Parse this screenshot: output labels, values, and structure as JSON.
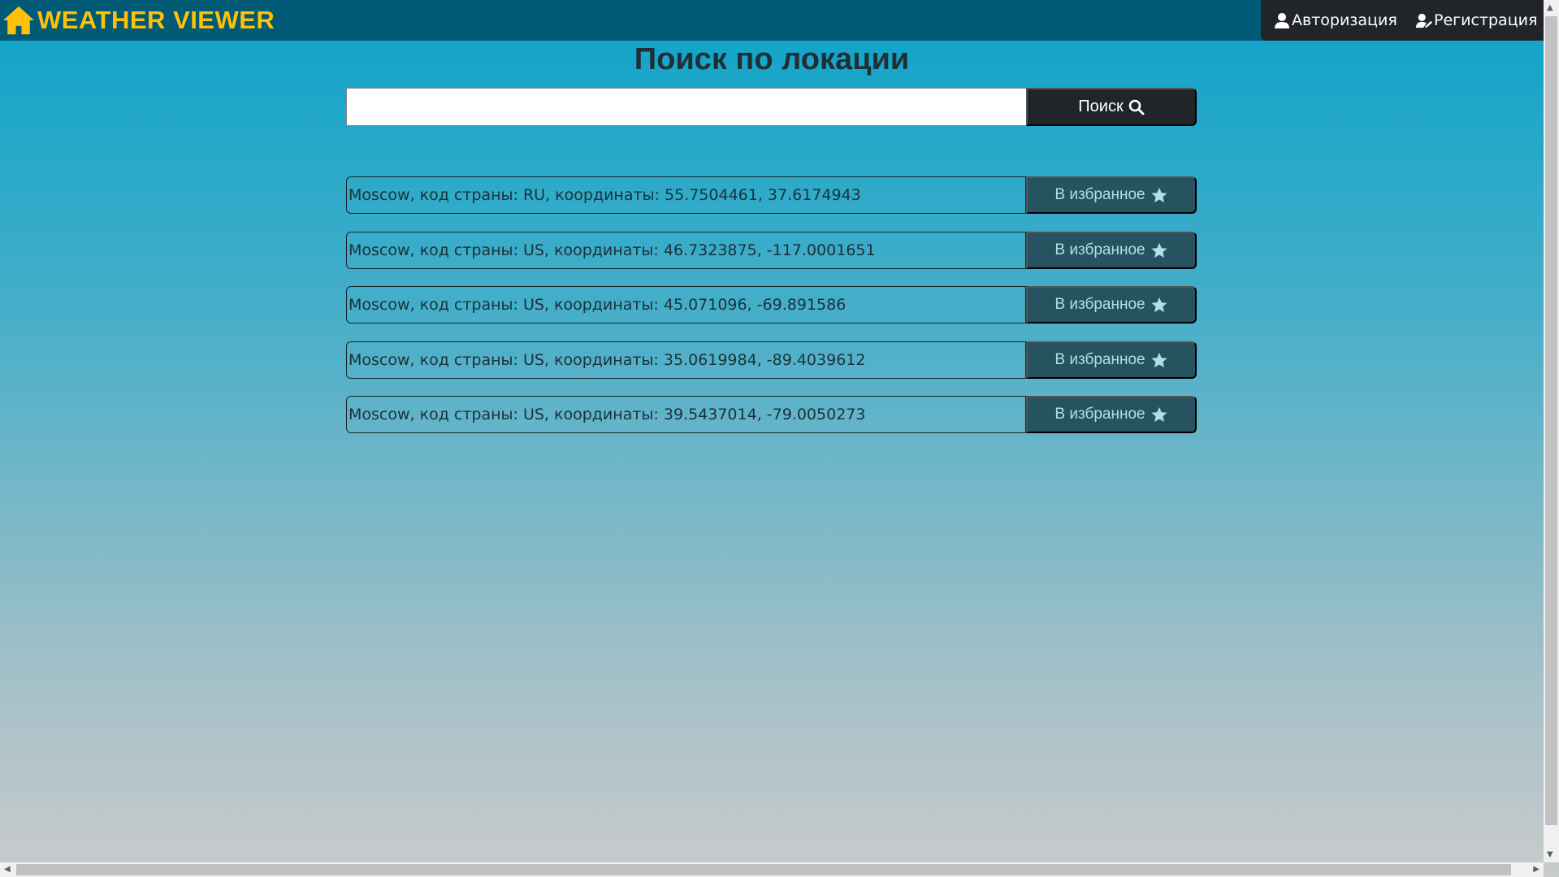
{
  "nav": {
    "brand": "WEATHER VIEWER",
    "login": "Авторизация",
    "register": "Регистрация"
  },
  "page": {
    "title": "Поиск по локации",
    "search_value": "",
    "search_button": "Поиск"
  },
  "results": [
    {
      "text": "Moscow, код страны: RU, координаты: 55.7504461, 37.6174943",
      "button": "В избранное"
    },
    {
      "text": "Moscow, код страны: US, координаты: 46.7323875, -117.0001651",
      "button": "В избранное"
    },
    {
      "text": "Moscow, код страны: US, координаты: 45.071096, -69.891586",
      "button": "В избранное"
    },
    {
      "text": "Moscow, код страны: US, координаты: 35.0619984, -89.4039612",
      "button": "В избранное"
    },
    {
      "text": "Moscow, код страны: US, координаты: 39.5437014, -79.0050273",
      "button": "В избранное"
    }
  ],
  "colors": {
    "navbar": "#015a75",
    "brand": "#ffc107",
    "dark_button": "#212529",
    "favorite_button": "#27525f"
  }
}
